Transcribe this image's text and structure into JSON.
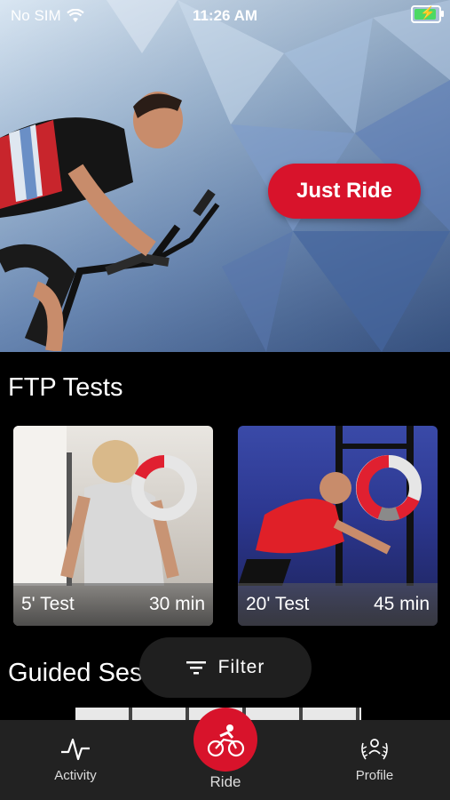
{
  "status_bar": {
    "carrier": "No SIM",
    "time": "11:26 AM"
  },
  "hero": {
    "cta_label": "Just Ride"
  },
  "ftp": {
    "title": "FTP Tests",
    "cards": [
      {
        "name": "5' Test",
        "duration": "30 min"
      },
      {
        "name": "20' Test",
        "duration": "45 min"
      }
    ]
  },
  "guided": {
    "title": "Guided Ses"
  },
  "filter": {
    "label": "Filter"
  },
  "tabs": {
    "activity": "Activity",
    "ride": "Ride",
    "profile": "Profile"
  },
  "colors": {
    "accent": "#d8132b",
    "tabbar": "#222222"
  }
}
